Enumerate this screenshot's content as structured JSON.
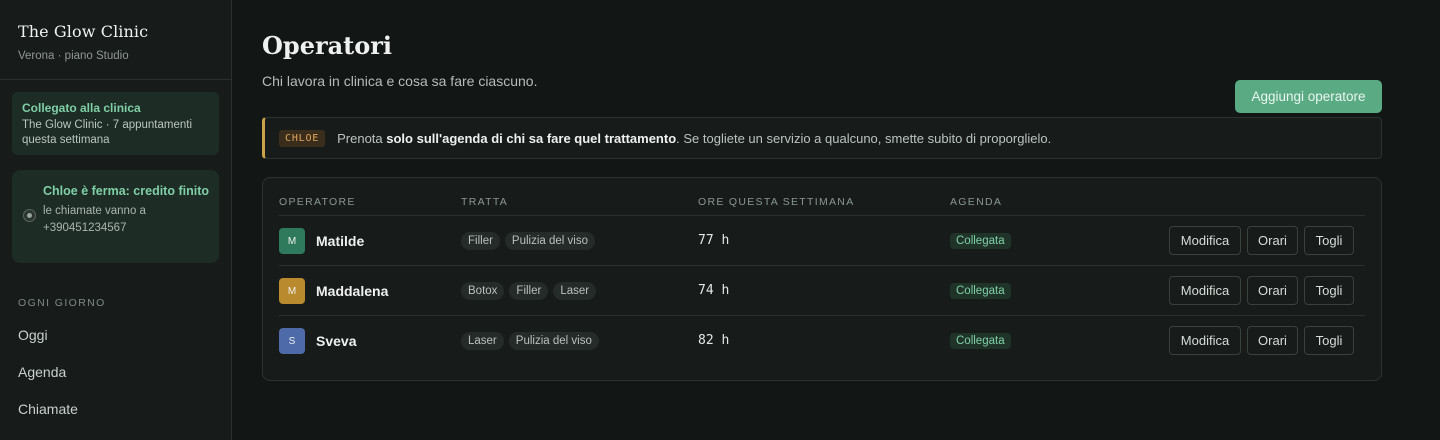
{
  "sidebar": {
    "brand_name": "The Glow Clinic",
    "brand_sub": "Verona · piano Studio",
    "connected_title": "Collegato alla clinica",
    "connected_text": "The Glow Clinic · 7 appuntamenti questa settimana",
    "stopped_title": "Chloe è ferma: credito finito",
    "stopped_text": "le chiamate vanno a +390451234567",
    "section_label": "OGNI GIORNO",
    "nav": [
      "Oggi",
      "Agenda",
      "Chiamate"
    ]
  },
  "main": {
    "title": "Operatori",
    "subtitle": "Chi lavora in clinica e cosa sa fare ciascuno.",
    "add_button": "Aggiungi operatore",
    "notice": {
      "tag": "CHLOE",
      "prefix": "Prenota ",
      "bold": "solo sull'agenda di chi sa fare quel trattamento",
      "suffix": ". Se togliete un servizio a qualcuno, smette subito di proporglielo."
    },
    "table": {
      "headers": [
        "OPERATORE",
        "TRATTA",
        "ORE QUESTA SETTIMANA",
        "AGENDA"
      ],
      "rows": [
        {
          "initial": "M",
          "name": "Matilde",
          "avatar_color": "#2f7a5c",
          "treatments": [
            "Filler",
            "Pulizia del viso"
          ],
          "hours": "77 h",
          "agenda": "Collegata"
        },
        {
          "initial": "M",
          "name": "Maddalena",
          "avatar_color": "#b98a2e",
          "treatments": [
            "Botox",
            "Filler",
            "Laser"
          ],
          "hours": "74 h",
          "agenda": "Collegata"
        },
        {
          "initial": "S",
          "name": "Sveva",
          "avatar_color": "#4f6aa8",
          "treatments": [
            "Laser",
            "Pulizia del viso"
          ],
          "hours": "82 h",
          "agenda": "Collegata"
        }
      ],
      "actions": {
        "edit": "Modifica",
        "hours": "Orari",
        "remove": "Togli"
      }
    }
  },
  "colors": {
    "accent": "#5aaa84",
    "notice_border": "#c9a24a",
    "badge_text": "#7fcfa6"
  }
}
